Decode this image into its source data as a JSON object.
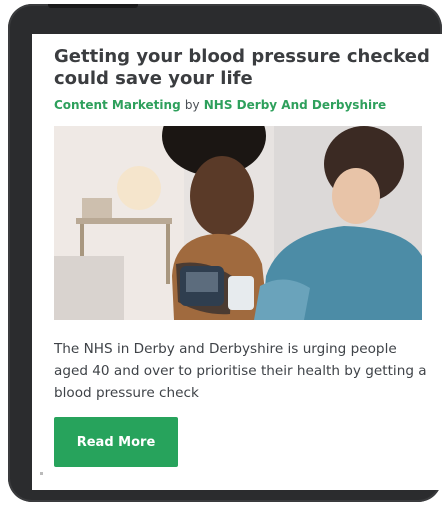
{
  "article": {
    "title": "Getting your blood pressure checked could save your life",
    "category": "Content Marketing",
    "by": "by",
    "author": "NHS Derby And Derbyshire",
    "description": "The NHS in Derby and Derbyshire is urging people aged 40 and over to prioritise their health by getting a blood pressure check",
    "cta_label": "Read More"
  },
  "colors": {
    "accent_green": "#27a35c",
    "byline_green": "#2ea05c",
    "title_text": "#3b3d40",
    "device_frame": "#2b2c2e"
  }
}
